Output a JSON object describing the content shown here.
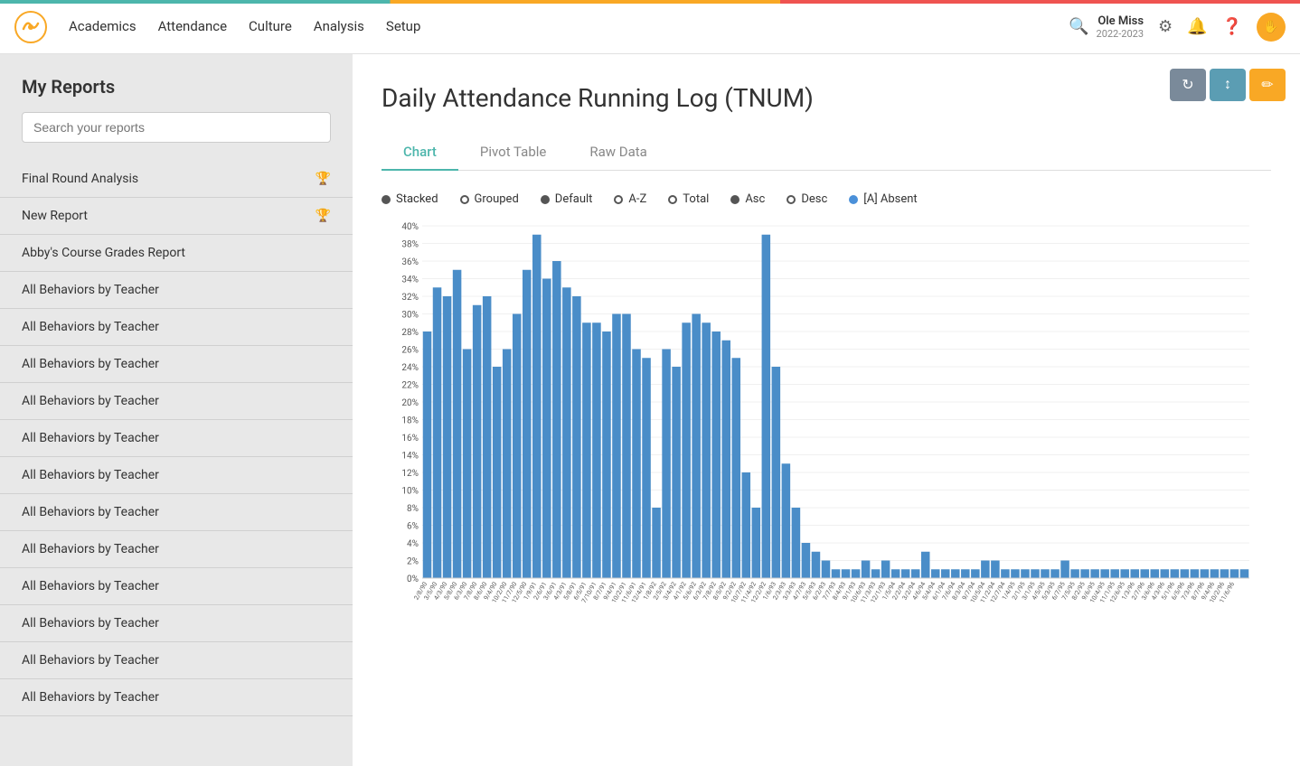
{
  "topbar": {
    "nav": [
      "Academics",
      "Attendance",
      "Culture",
      "Analysis",
      "Setup"
    ],
    "user": {
      "name": "Ole Miss",
      "year": "2022-2023"
    },
    "icons": [
      "gear-icon",
      "bell-icon",
      "help-icon",
      "avatar-icon"
    ]
  },
  "sidebar": {
    "title": "My Reports",
    "search_placeholder": "Search your reports",
    "reports": [
      {
        "label": "Final Round Analysis",
        "icon": "🏆"
      },
      {
        "label": "New Report",
        "icon": "🏆"
      },
      {
        "label": "Abby's Course Grades Report",
        "icon": ""
      },
      {
        "label": "All Behaviors by Teacher",
        "icon": ""
      },
      {
        "label": "All Behaviors by Teacher",
        "icon": ""
      },
      {
        "label": "All Behaviors by Teacher",
        "icon": ""
      },
      {
        "label": "All Behaviors by Teacher",
        "icon": ""
      },
      {
        "label": "All Behaviors by Teacher",
        "icon": ""
      },
      {
        "label": "All Behaviors by Teacher",
        "icon": ""
      },
      {
        "label": "All Behaviors by Teacher",
        "icon": ""
      },
      {
        "label": "All Behaviors by Teacher",
        "icon": ""
      },
      {
        "label": "All Behaviors by Teacher",
        "icon": ""
      },
      {
        "label": "All Behaviors by Teacher",
        "icon": ""
      },
      {
        "label": "All Behaviors by Teacher",
        "icon": ""
      },
      {
        "label": "All Behaviors by Teacher",
        "icon": ""
      }
    ]
  },
  "toolbar": {
    "refresh_label": "↻",
    "sort_label": "↕",
    "edit_label": "✏"
  },
  "main": {
    "title": "Daily Attendance Running Log (TNUM)",
    "tabs": [
      "Chart",
      "Pivot Table",
      "Raw Data"
    ],
    "active_tab": "Chart"
  },
  "chart": {
    "legend": [
      {
        "type": "filled",
        "label": "Stacked"
      },
      {
        "type": "outline",
        "label": "Grouped"
      },
      {
        "type": "filled",
        "label": "Default"
      },
      {
        "type": "outline",
        "label": "A-Z"
      },
      {
        "type": "outline",
        "label": "Total"
      },
      {
        "type": "filled",
        "label": "Asc"
      },
      {
        "type": "outline",
        "label": "Desc"
      },
      {
        "type": "blue",
        "label": "[A] Absent"
      }
    ],
    "y_labels": [
      "40%",
      "38%",
      "36%",
      "34%",
      "32%",
      "30%",
      "28%",
      "26%",
      "24%",
      "22%",
      "20%",
      "18%",
      "16%",
      "14%",
      "12%",
      "10%",
      "8%",
      "6%",
      "4%",
      "2%",
      "0%"
    ],
    "bars": [
      28,
      33,
      32,
      35,
      26,
      31,
      32,
      24,
      26,
      30,
      35,
      39,
      34,
      36,
      33,
      32,
      29,
      29,
      28,
      30,
      30,
      26,
      25,
      8,
      26,
      24,
      29,
      30,
      29,
      28,
      27,
      25,
      12,
      8,
      39,
      24,
      13,
      8,
      4,
      3,
      2,
      1,
      1,
      1,
      2,
      1,
      2,
      1,
      1,
      1,
      3,
      1,
      1,
      1,
      1,
      1,
      2,
      2,
      1,
      1,
      1,
      1,
      1,
      1,
      2,
      1,
      1,
      1,
      1,
      1,
      1,
      1,
      1,
      1,
      1,
      1,
      1,
      1,
      1,
      1,
      1,
      1,
      1
    ]
  }
}
